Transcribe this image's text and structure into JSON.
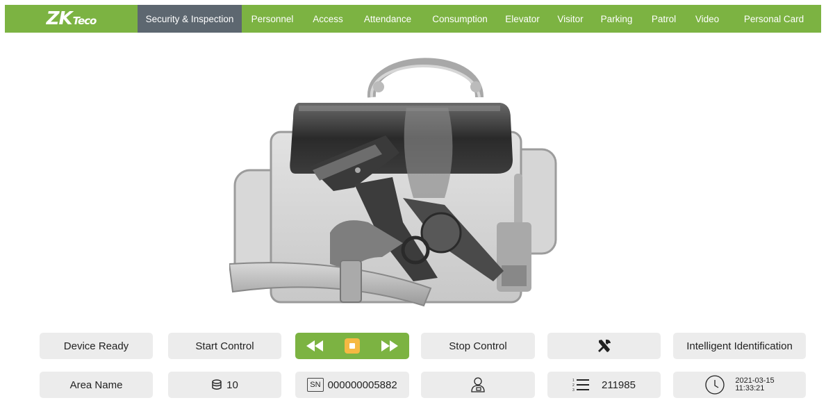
{
  "brand": {
    "logo_main": "ZK",
    "logo_sub": "Teco"
  },
  "nav": {
    "items": [
      {
        "label": "Security & Inspection",
        "active": true
      },
      {
        "label": "Personnel",
        "active": false
      },
      {
        "label": "Access",
        "active": false
      },
      {
        "label": "Attendance",
        "active": false
      },
      {
        "label": "Consumption",
        "active": false
      },
      {
        "label": "Elevator",
        "active": false
      },
      {
        "label": "Visitor",
        "active": false
      },
      {
        "label": "Parking",
        "active": false
      },
      {
        "label": "Patrol",
        "active": false
      },
      {
        "label": "Video",
        "active": false
      },
      {
        "label": "Personal Card",
        "active": false
      }
    ]
  },
  "panel": {
    "device_status": "Device Ready",
    "start_control": "Start Control",
    "stop_control": "Stop Control",
    "intelligent": "Intelligent Identification",
    "area_name": "Area Name",
    "layers_count": "10",
    "sn_label": "SN",
    "serial_number": "000000005882",
    "list_count": "211985",
    "date": "2021-03-15",
    "time": "11:33:21"
  },
  "colors": {
    "accent": "#7cb342",
    "nav_active": "#5d6770",
    "button_bg": "#ececec",
    "stop_button": "#f5b942"
  },
  "icons": [
    "rewind-icon",
    "stop-icon",
    "fast-forward-icon",
    "tools-icon",
    "database-icon",
    "user-icon",
    "numbered-list-icon",
    "clock-icon"
  ]
}
